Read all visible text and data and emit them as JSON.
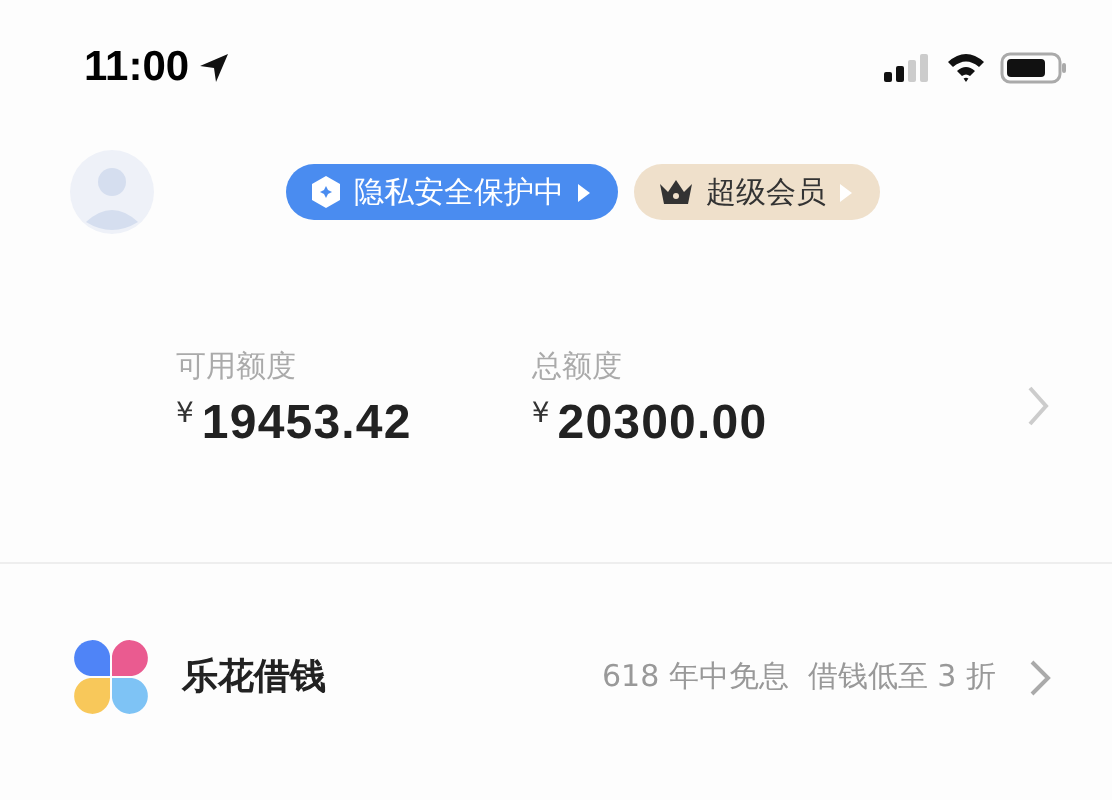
{
  "status_bar": {
    "time": "11:00"
  },
  "profile": {
    "badges": [
      {
        "kind": "privacy",
        "label": "隐私安全保护中"
      },
      {
        "kind": "vip",
        "label": "超级会员"
      }
    ]
  },
  "credit": {
    "items": [
      {
        "label": "可用额度",
        "currency": "¥",
        "amount": "19453.42"
      },
      {
        "label": "总额度",
        "currency": "¥",
        "amount": "20300.00"
      }
    ]
  },
  "loan": {
    "title": "乐花借钱",
    "promo": "618 年中免息  借钱低至 3 折"
  }
}
